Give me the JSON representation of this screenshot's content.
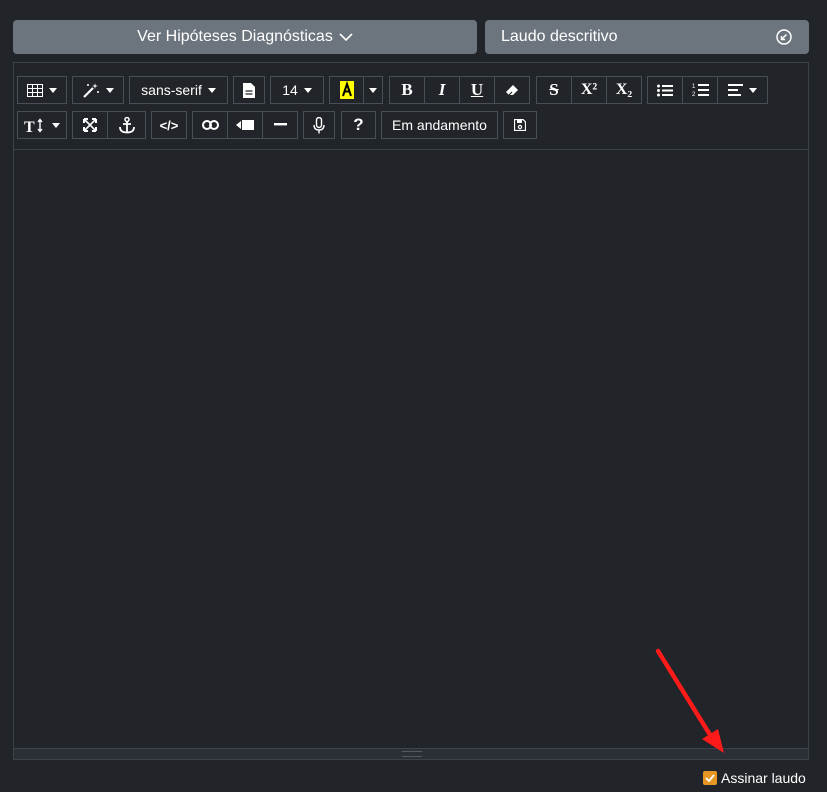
{
  "top": {
    "hypotheses_label": "Ver Hipóteses Diagnósticas",
    "report_label": "Laudo descritivo"
  },
  "toolbar": {
    "font_name": "sans-serif",
    "font_size": "14",
    "status_label": "Em andamento",
    "bold": "B",
    "italic": "I",
    "underline": "U",
    "strike": "S",
    "superscript": "X²",
    "subscript": "X₂",
    "help": "?",
    "code": "</>"
  },
  "footer": {
    "sign_label": "Assinar laudo",
    "sign_checked": true
  },
  "colors": {
    "background": "#212428",
    "button": "#6c757d",
    "checkbox": "#e59623",
    "highlight": "#ffff00",
    "annotation_arrow": "#ff1a1a"
  }
}
